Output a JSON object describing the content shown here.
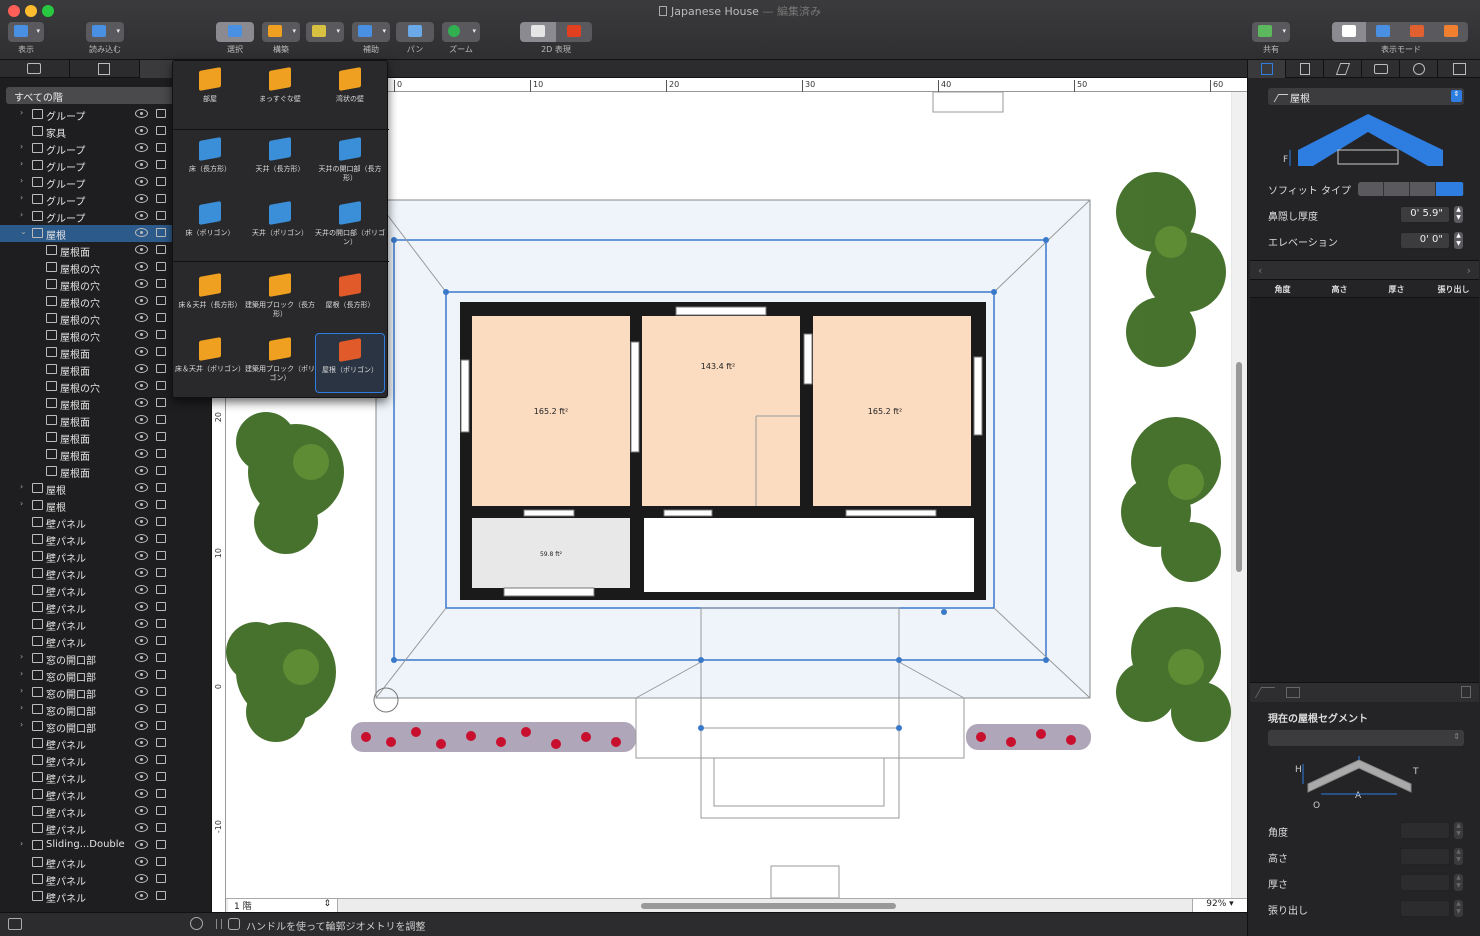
{
  "window": {
    "title": "Japanese House",
    "title_status": "— 編集済み"
  },
  "toolbar": {
    "view_label": "表示",
    "import_label": "読み込む",
    "select_label": "選択",
    "build_label": "構築",
    "annotate_label": "補助",
    "pan_label": "パン",
    "zoom_label": "ズーム",
    "view2d_label": "2D 表現",
    "share_label": "共有",
    "viewmode_label": "表示モード"
  },
  "floor_selector": "すべての階",
  "layers": [
    {
      "name": "グループ",
      "icon": "folder-icon",
      "arrow": true,
      "indent": 0
    },
    {
      "name": "家具",
      "icon": "chair-icon",
      "arrow": false,
      "indent": 0
    },
    {
      "name": "グループ",
      "icon": "folder-icon",
      "arrow": true,
      "indent": 0
    },
    {
      "name": "グループ",
      "icon": "folder-icon",
      "arrow": true,
      "indent": 0
    },
    {
      "name": "グループ",
      "icon": "folder-icon",
      "arrow": true,
      "indent": 0
    },
    {
      "name": "グループ",
      "icon": "folder-icon",
      "arrow": true,
      "indent": 0
    },
    {
      "name": "グループ",
      "icon": "folder-icon",
      "arrow": true,
      "indent": 0
    },
    {
      "name": "屋根",
      "icon": "roof-icon",
      "arrow": true,
      "indent": 0,
      "selected": true
    },
    {
      "name": "屋根面",
      "icon": "roof-face-icon",
      "arrow": false,
      "indent": 1
    },
    {
      "name": "屋根の穴",
      "icon": "roof-hole-icon",
      "arrow": false,
      "indent": 1
    },
    {
      "name": "屋根の穴",
      "icon": "roof-hole-icon",
      "arrow": false,
      "indent": 1
    },
    {
      "name": "屋根の穴",
      "icon": "roof-hole-icon",
      "arrow": false,
      "indent": 1
    },
    {
      "name": "屋根の穴",
      "icon": "roof-hole-icon",
      "arrow": false,
      "indent": 1
    },
    {
      "name": "屋根の穴",
      "icon": "roof-hole-icon",
      "arrow": false,
      "indent": 1
    },
    {
      "name": "屋根面",
      "icon": "roof-face-icon",
      "arrow": false,
      "indent": 1
    },
    {
      "name": "屋根面",
      "icon": "roof-face-icon",
      "arrow": false,
      "indent": 1
    },
    {
      "name": "屋根の穴",
      "icon": "roof-hole-icon",
      "arrow": false,
      "indent": 1
    },
    {
      "name": "屋根面",
      "icon": "roof-face-icon",
      "arrow": false,
      "indent": 1
    },
    {
      "name": "屋根面",
      "icon": "roof-face-icon",
      "arrow": false,
      "indent": 1
    },
    {
      "name": "屋根面",
      "icon": "roof-face-icon",
      "arrow": false,
      "indent": 1
    },
    {
      "name": "屋根面",
      "icon": "roof-face-icon",
      "arrow": false,
      "indent": 1
    },
    {
      "name": "屋根面",
      "icon": "roof-face-icon",
      "arrow": false,
      "indent": 1
    },
    {
      "name": "屋根",
      "icon": "roof-icon",
      "arrow": true,
      "indent": 0
    },
    {
      "name": "屋根",
      "icon": "roof-icon",
      "arrow": true,
      "indent": 0
    },
    {
      "name": "壁パネル",
      "icon": "wall-panel-icon",
      "arrow": false,
      "indent": 0
    },
    {
      "name": "壁パネル",
      "icon": "wall-panel-icon",
      "arrow": false,
      "indent": 0
    },
    {
      "name": "壁パネル",
      "icon": "wall-panel-icon",
      "arrow": false,
      "indent": 0
    },
    {
      "name": "壁パネル",
      "icon": "wall-panel-icon",
      "arrow": false,
      "indent": 0
    },
    {
      "name": "壁パネル",
      "icon": "wall-panel-icon",
      "arrow": false,
      "indent": 0
    },
    {
      "name": "壁パネル",
      "icon": "wall-panel-icon",
      "arrow": false,
      "indent": 0
    },
    {
      "name": "壁パネル",
      "icon": "wall-panel-icon",
      "arrow": false,
      "indent": 0
    },
    {
      "name": "壁パネル",
      "icon": "wall-panel-icon",
      "arrow": false,
      "indent": 0
    },
    {
      "name": "窓の開口部",
      "icon": "window-opening-icon",
      "arrow": true,
      "indent": 0
    },
    {
      "name": "窓の開口部",
      "icon": "window-opening-icon",
      "arrow": true,
      "indent": 0
    },
    {
      "name": "窓の開口部",
      "icon": "window-opening-icon",
      "arrow": true,
      "indent": 0
    },
    {
      "name": "窓の開口部",
      "icon": "window-opening-icon",
      "arrow": true,
      "indent": 0
    },
    {
      "name": "窓の開口部",
      "icon": "window-opening-icon",
      "arrow": true,
      "indent": 0
    },
    {
      "name": "壁パネル",
      "icon": "wall-panel-icon",
      "arrow": false,
      "indent": 0
    },
    {
      "name": "壁パネル",
      "icon": "wall-panel-icon",
      "arrow": false,
      "indent": 0
    },
    {
      "name": "壁パネル",
      "icon": "wall-panel-icon",
      "arrow": false,
      "indent": 0
    },
    {
      "name": "壁パネル",
      "icon": "wall-panel-icon",
      "arrow": false,
      "indent": 0
    },
    {
      "name": "壁パネル",
      "icon": "wall-panel-icon",
      "arrow": false,
      "indent": 0
    },
    {
      "name": "壁パネル",
      "icon": "wall-panel-icon",
      "arrow": false,
      "indent": 0
    },
    {
      "name": "Sliding...Double",
      "icon": "door-icon",
      "arrow": true,
      "indent": 0
    },
    {
      "name": "壁パネル",
      "icon": "wall-panel-icon",
      "arrow": false,
      "indent": 0
    },
    {
      "name": "壁パネル",
      "icon": "wall-panel-icon",
      "arrow": false,
      "indent": 0
    },
    {
      "name": "壁パネル",
      "icon": "wall-panel-icon",
      "arrow": false,
      "indent": 0
    }
  ],
  "build_menu": {
    "items": [
      {
        "label": "部屋",
        "icon": "room-icon"
      },
      {
        "label": "まっすぐな壁",
        "icon": "straight-wall-icon"
      },
      {
        "label": "湾状の壁",
        "icon": "curved-wall-icon"
      },
      {
        "label": "床（長方形）",
        "icon": "floor-rect-icon"
      },
      {
        "label": "天井（長方形）",
        "icon": "ceiling-rect-icon"
      },
      {
        "label": "天井の開口部（長方形）",
        "icon": "ceiling-opening-rect-icon"
      },
      {
        "label": "床（ポリゴン）",
        "icon": "floor-polygon-icon"
      },
      {
        "label": "天井（ポリゴン）",
        "icon": "ceiling-polygon-icon"
      },
      {
        "label": "天井の開口部（ポリゴン）",
        "icon": "ceiling-opening-polygon-icon"
      },
      {
        "label": "床＆天井（長方形）",
        "icon": "floor-ceiling-rect-icon"
      },
      {
        "label": "建築用ブロック（長方形）",
        "icon": "block-rect-icon"
      },
      {
        "label": "屋根（長方形）",
        "icon": "roof-rect-icon"
      },
      {
        "label": "床＆天井（ポリゴン）",
        "icon": "floor-ceiling-polygon-icon"
      },
      {
        "label": "建築用ブロック（ポリゴン）",
        "icon": "block-polygon-icon"
      },
      {
        "label": "屋根（ポリゴン）",
        "icon": "roof-polygon-icon"
      }
    ],
    "selected_index": 14
  },
  "ruler": {
    "top_ticks": [
      "0",
      "10",
      "20",
      "30",
      "40",
      "50",
      "60"
    ],
    "left_ticks": [
      "20",
      "10",
      "0",
      "-10"
    ]
  },
  "plan": {
    "room_left_area": "165.2 ft²",
    "room_center_area": "143.4 ft²",
    "room_right_area": "165.2 ft²",
    "room_small_area": "59.8 ft²"
  },
  "statusbar": {
    "floor_name": "1 階",
    "hint": "ハンドルを使って輪郭ジオメトリを調整",
    "zoom": "92%"
  },
  "inspector": {
    "object_type": "屋根",
    "soffit_label": "ソフィット タイプ",
    "eave_label": "鼻隠し厚度",
    "eave_value": "0' 5.9\"",
    "elevation_label": "エレベーション",
    "elevation_value": "0' 0\"",
    "table_headers": [
      "角度",
      "高さ",
      "厚さ",
      "張り出し"
    ],
    "segment_title": "現在の屋根セグメント",
    "seg_fields": [
      "角度",
      "高さ",
      "厚さ",
      "張り出し"
    ],
    "diagram_letters": {
      "h": "H",
      "t": "T",
      "o": "O",
      "a": "A",
      "f": "F"
    }
  },
  "colors": {
    "accent": "#2e7de0",
    "room_fill": "#fcdcc0",
    "roof_line": "#3a78c9",
    "wall": "#1a1a1a"
  }
}
